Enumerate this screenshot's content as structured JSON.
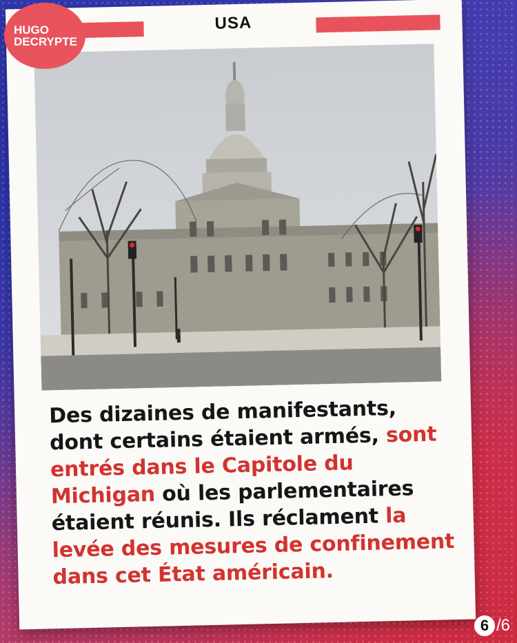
{
  "brand": {
    "line1": "HUGO",
    "line2": "DECRYPTE",
    "color": "#e9535b"
  },
  "category": "USA",
  "photo": {
    "description_icon": "capitol-photo"
  },
  "caption": {
    "part1": "Des dizaines de manifestants, dont certains étaient armés, ",
    "highlight1": "sont entrés dans le Capitole du Michigan",
    "part2": " où les parlementaires étaient réunis. Ils réclament ",
    "highlight2": "la levée des mesures de confinement dans cet État américain."
  },
  "pager": {
    "current": "6",
    "total": "/6"
  },
  "colors": {
    "accent": "#d2332f",
    "bar": "#e8525a"
  }
}
